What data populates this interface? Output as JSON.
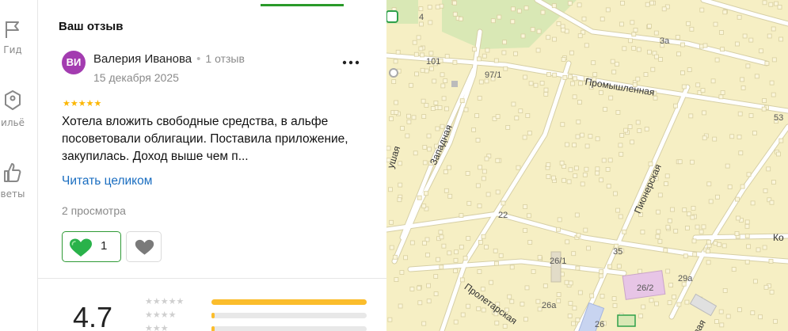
{
  "rail": {
    "items": [
      {
        "icon": "flag-icon",
        "label": "Гид"
      },
      {
        "icon": "tag-icon",
        "label": "ильё"
      },
      {
        "icon": "thumb-up-icon",
        "label": "веты"
      }
    ]
  },
  "review": {
    "section_title": "Ваш отзыв",
    "avatar_initials": "ВИ",
    "author_name": "Валерия Иванова",
    "author_reviews": "1 отзыв",
    "date": "15 декабря 2025",
    "stars": "★★★★★",
    "rating": 5,
    "text": "Хотела вложить свободные средства, в альфе посоветовали облигации. Поставила приложение, закупилась. Доход выше чем п...",
    "read_more": "Читать целиком",
    "views": "2 просмотра",
    "like_count": "1",
    "colors": {
      "accent": "#2e9a35",
      "link": "#196dc0",
      "star": "#fcb600",
      "avatar": "#a33cb0"
    }
  },
  "summary": {
    "rating": "4.7",
    "distribution": [
      {
        "stars": "★★★★★",
        "fraction": 1.0
      },
      {
        "stars": "★★★★",
        "fraction": 0.01
      },
      {
        "stars": "★★★",
        "fraction": 0.01
      }
    ]
  },
  "map": {
    "streets": [
      "Промышленная",
      "Западная",
      "Пионерская",
      "Пролетарская",
      "ушая",
      "Ко",
      "вая"
    ],
    "house_numbers": [
      "4",
      "101",
      "97/1",
      "3а",
      "53",
      "22",
      "26/1",
      "35",
      "26/2",
      "29а",
      "26а",
      "26"
    ]
  }
}
